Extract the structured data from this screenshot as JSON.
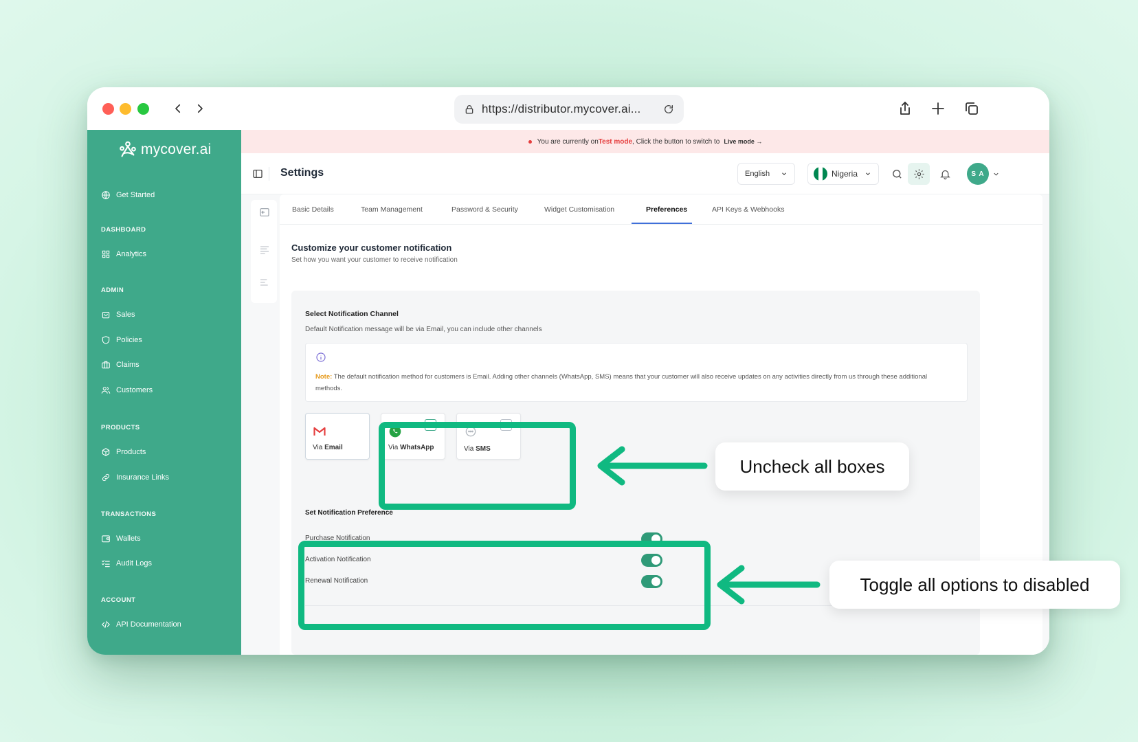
{
  "browser": {
    "url": "https://distributor.mycover.ai..."
  },
  "sidebar": {
    "logo_text": "mycover.ai",
    "get_started": "Get Started",
    "sections": [
      {
        "label": "DASHBOARD",
        "items": [
          "Analytics"
        ]
      },
      {
        "label": "ADMIN",
        "items": [
          "Sales",
          "Policies",
          "Claims",
          "Customers"
        ]
      },
      {
        "label": "PRODUCTS",
        "items": [
          "Products",
          "Insurance Links"
        ]
      },
      {
        "label": "TRANSACTIONS",
        "items": [
          "Wallets",
          "Audit Logs"
        ]
      },
      {
        "label": "ACCOUNT",
        "items": [
          "API Documentation"
        ]
      }
    ]
  },
  "banner": {
    "prefix": "You are currently on ",
    "mode": "Test mode",
    "suffix": ", Click the button to switch to",
    "live_link": "Live mode"
  },
  "header": {
    "title": "Settings",
    "language": "English",
    "country": "Nigeria",
    "avatar_initials": "S A"
  },
  "tabs": [
    "Basic Details",
    "Team Management",
    "Password & Security",
    "Widget Customisation",
    "Preferences",
    "API Keys & Webhooks"
  ],
  "active_tab": "Preferences",
  "section": {
    "title": "Customize your customer notification",
    "subtitle": "Set how you want your customer to receive notification"
  },
  "channel": {
    "title": "Select Notification Channel",
    "subtitle": "Default Notification message will be via Email, you can include other channels",
    "note_label": "Note:",
    "note_text": " The default notification method for customers is Email. Adding other channels (WhatsApp, SMS) means that your customer will also receive updates on any activities directly from us through these additional methods.",
    "options": [
      {
        "prefix": "Via ",
        "name": "Email",
        "checked": false
      },
      {
        "prefix": "Via ",
        "name": "WhatsApp",
        "checked": false
      },
      {
        "prefix": "Via ",
        "name": "SMS",
        "checked": false
      }
    ]
  },
  "preferences": {
    "title": "Set Notification Preference",
    "items": [
      {
        "label": "Purchase Notification",
        "enabled": true
      },
      {
        "label": "Activation Notification",
        "enabled": true
      },
      {
        "label": "Renewal Notification",
        "enabled": true
      }
    ]
  },
  "annotations": {
    "callout_1": "Uncheck all boxes",
    "callout_2": "Toggle all options to disabled",
    "highlight_color": "#10b981"
  },
  "colors": {
    "sidebar": "#3fa98a",
    "toggle_on": "#2f9a78",
    "test_mode": "#e53e3e",
    "note_label": "#e69a1c",
    "tab_active": "#3f6fd9"
  }
}
